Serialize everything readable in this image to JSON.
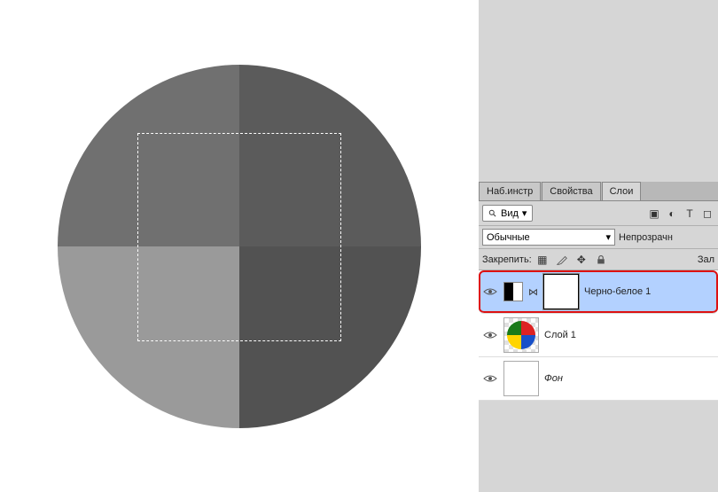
{
  "tabs": {
    "tools": "Наб.инстр",
    "properties": "Свойства",
    "layers": "Слои"
  },
  "filter": {
    "kind_label": "Вид"
  },
  "blend": {
    "mode": "Обычные",
    "opacity_label": "Непрозрачн"
  },
  "lock": {
    "label": "Закрепить:",
    "fill_label": "Зал"
  },
  "layers": [
    {
      "name": "Черно-белое 1",
      "type": "adjustment",
      "selected": true,
      "visible": true
    },
    {
      "name": "Слой 1",
      "type": "pixel",
      "selected": false,
      "visible": true
    },
    {
      "name": "Фон",
      "type": "background",
      "selected": false,
      "visible": true
    }
  ]
}
